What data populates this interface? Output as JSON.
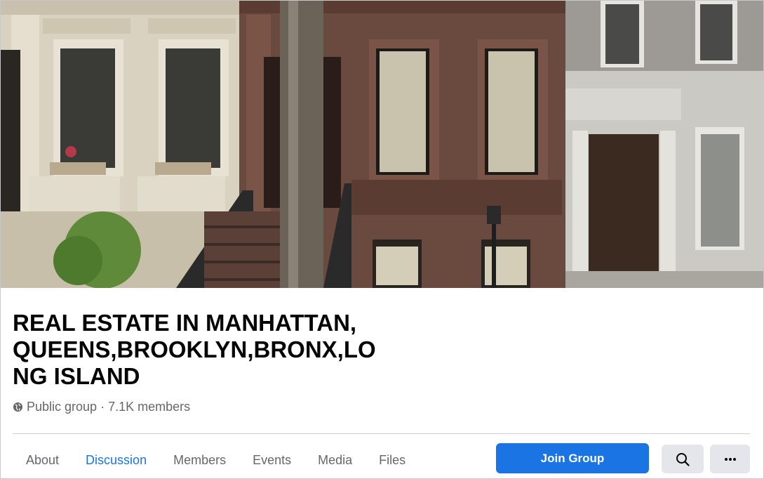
{
  "cover": {
    "image": "brownstone-townhouses-cover-photo"
  },
  "group": {
    "title": "REAL ESTATE IN MANHATTAN, QUEENS,BROOKLYN,BRONX,LONG ISLAND",
    "privacy": "Public group",
    "separator": "·",
    "members": "7.1K members",
    "privacy_icon": "globe-icon"
  },
  "tabs": [
    {
      "label": "About",
      "active": false
    },
    {
      "label": "Discussion",
      "active": true
    },
    {
      "label": "Members",
      "active": false
    },
    {
      "label": "Events",
      "active": false
    },
    {
      "label": "Media",
      "active": false
    },
    {
      "label": "Files",
      "active": false
    }
  ],
  "actions": {
    "join_label": "Join Group",
    "search_icon": "search-icon",
    "more_icon": "more-icon"
  },
  "colors": {
    "accent": "#1b74e4",
    "secondary_text": "#65676b",
    "button_gray": "#e4e6eb"
  }
}
